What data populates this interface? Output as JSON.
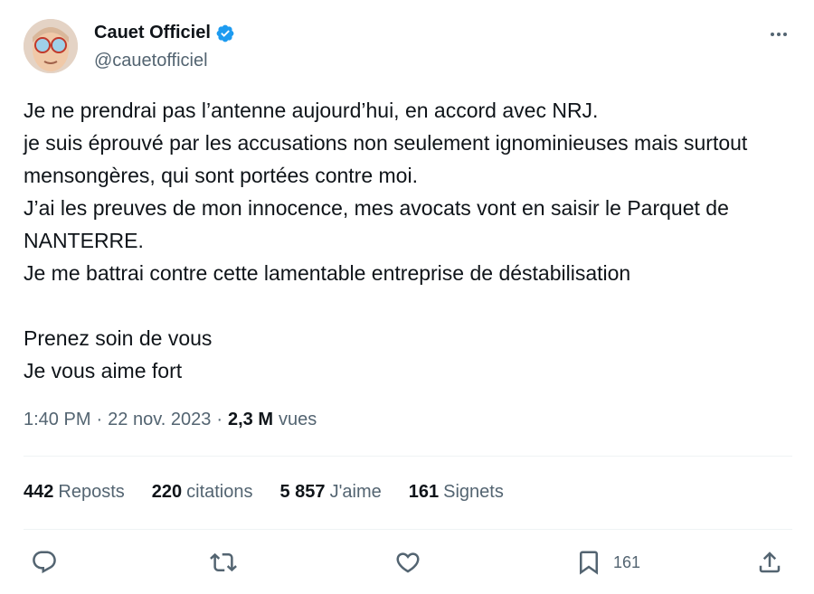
{
  "author": {
    "display_name": "Cauet Officiel",
    "handle": "@cauetofficiel",
    "verified": true
  },
  "tweet": {
    "text": "Je ne prendrai pas l’antenne aujourd’hui, en accord avec NRJ.\nje suis éprouvé par les accusations non seulement ignominieuses mais surtout mensongères, qui sont portées contre moi.\nJ’ai les preuves de mon innocence, mes avocats vont en saisir le Parquet de NANTERRE.\nJe me battrai contre cette lamentable entreprise de déstabilisation\n\nPrenez soin de vous\nJe vous aime fort",
    "time": "1:40 PM",
    "separator": "·",
    "date": "22 nov. 2023",
    "views": "2,3 M",
    "views_label": "vues"
  },
  "stats": {
    "reposts": {
      "count": "442",
      "label": "Reposts"
    },
    "quotes": {
      "count": "220",
      "label": "citations"
    },
    "likes": {
      "count": "5 857",
      "label": "J'aime"
    },
    "bookmarks": {
      "count": "161",
      "label": "Signets"
    }
  },
  "actions": {
    "bookmark_count": "161"
  },
  "colors": {
    "text": "#0f1419",
    "secondary": "#536471",
    "verified_blue": "#1d9bf0",
    "divider": "#eff3f4"
  },
  "icons": [
    "verified-badge-icon",
    "more-icon",
    "reply-icon",
    "repost-icon",
    "like-icon",
    "bookmark-icon",
    "share-icon"
  ]
}
